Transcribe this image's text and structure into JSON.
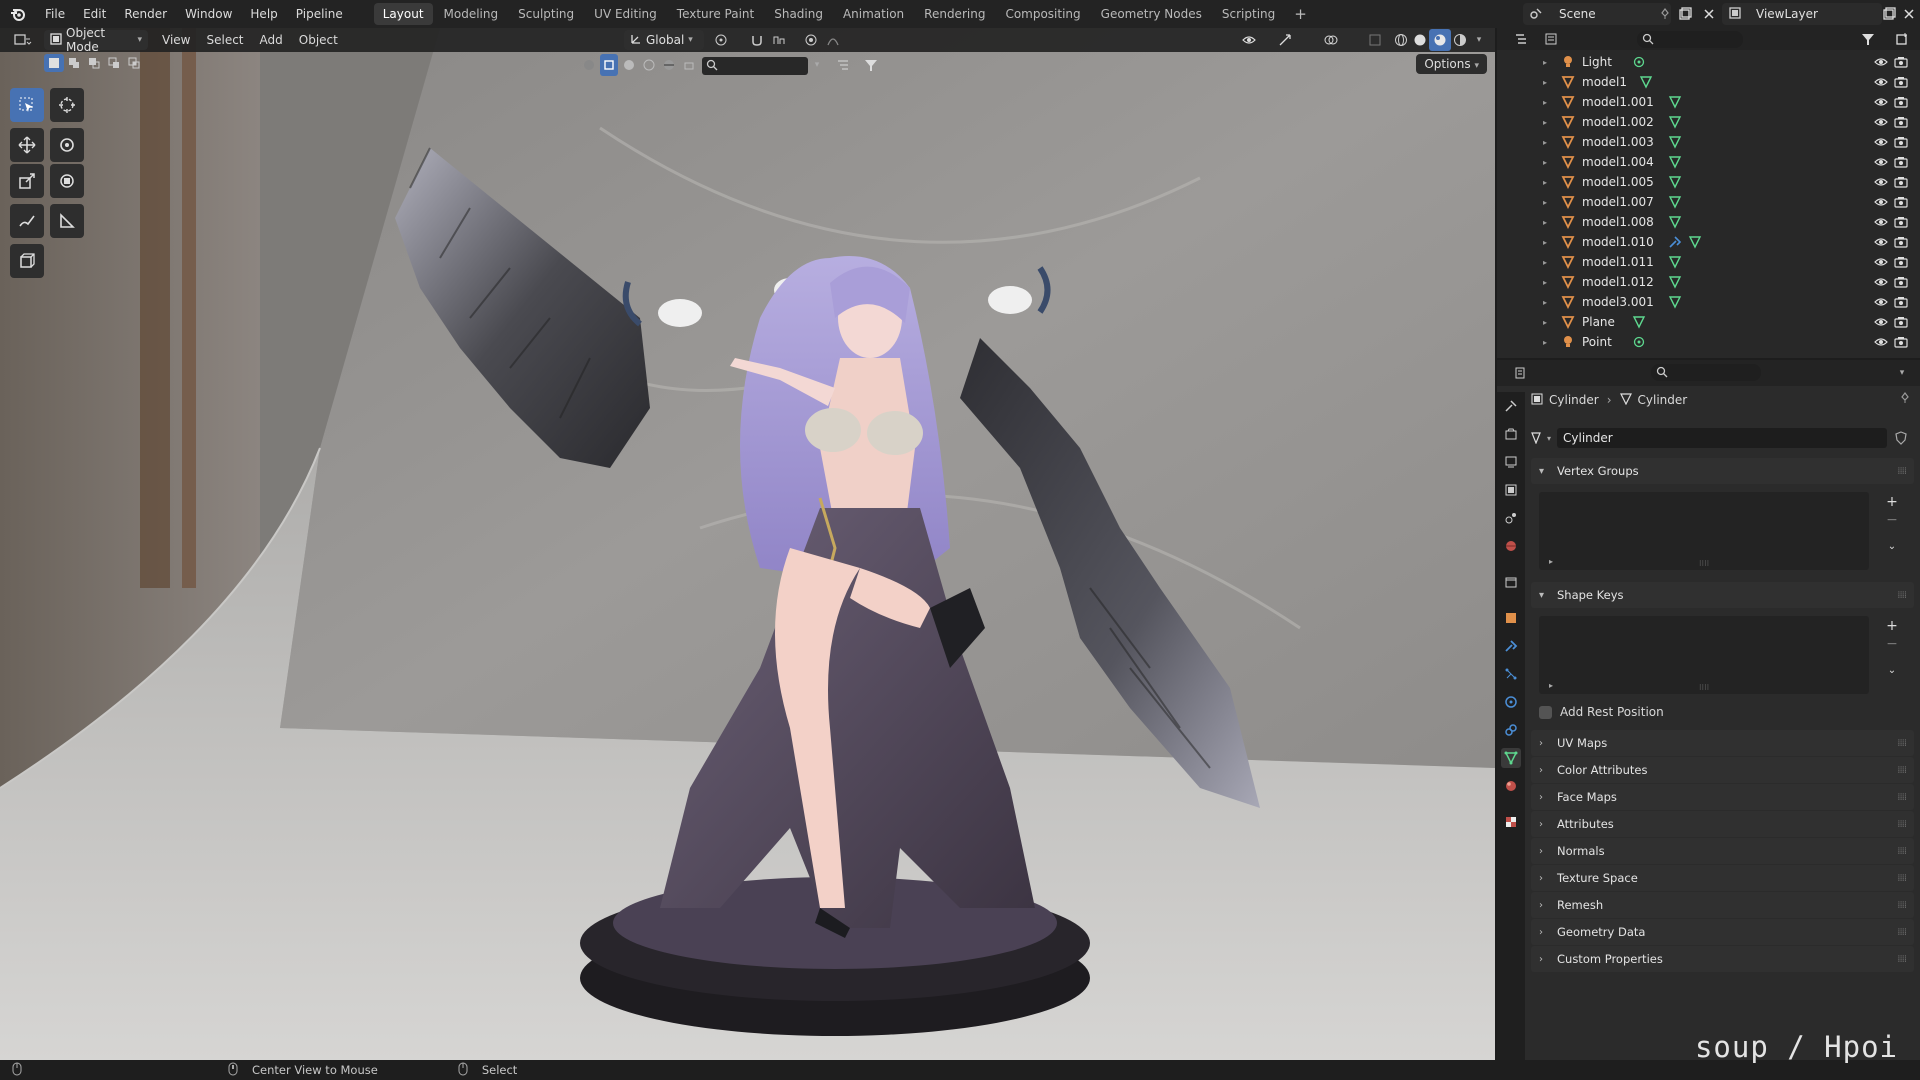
{
  "topbar": {
    "menus": [
      "File",
      "Edit",
      "Render",
      "Window",
      "Help",
      "Pipeline"
    ],
    "workspaces": [
      "Layout",
      "Modeling",
      "Sculpting",
      "UV Editing",
      "Texture Paint",
      "Shading",
      "Animation",
      "Rendering",
      "Compositing",
      "Geometry Nodes",
      "Scripting"
    ],
    "active_workspace": "Layout",
    "add_tab": "+",
    "scene_name": "Scene",
    "view_layer": "ViewLayer"
  },
  "viewport_header": {
    "mode": "Object Mode",
    "menus": [
      "View",
      "Select",
      "Add",
      "Object"
    ],
    "transform_orientation": "Global",
    "options_label": "Options"
  },
  "outliner": {
    "items": [
      {
        "name": "Light",
        "type": "light",
        "data": "light"
      },
      {
        "name": "model1",
        "type": "mesh",
        "data": "mesh"
      },
      {
        "name": "model1.001",
        "type": "mesh",
        "data": "mesh"
      },
      {
        "name": "model1.002",
        "type": "mesh",
        "data": "mesh"
      },
      {
        "name": "model1.003",
        "type": "mesh",
        "data": "mesh"
      },
      {
        "name": "model1.004",
        "type": "mesh",
        "data": "mesh"
      },
      {
        "name": "model1.005",
        "type": "mesh",
        "data": "mesh"
      },
      {
        "name": "model1.007",
        "type": "mesh",
        "data": "mesh"
      },
      {
        "name": "model1.008",
        "type": "mesh",
        "data": "mesh"
      },
      {
        "name": "model1.010",
        "type": "mesh",
        "data": "modifier+mesh"
      },
      {
        "name": "model1.011",
        "type": "mesh",
        "data": "mesh"
      },
      {
        "name": "model1.012",
        "type": "mesh",
        "data": "mesh"
      },
      {
        "name": "model3.001",
        "type": "mesh",
        "data": "mesh"
      },
      {
        "name": "Plane",
        "type": "mesh",
        "data": "mesh"
      },
      {
        "name": "Point",
        "type": "light",
        "data": "light"
      }
    ]
  },
  "properties": {
    "breadcrumb_object": "Cylinder",
    "breadcrumb_data": "Cylinder",
    "mesh_name": "Cylinder",
    "panels": {
      "vertex_groups": "Vertex Groups",
      "shape_keys": "Shape Keys",
      "add_rest_position": "Add Rest Position",
      "uv_maps": "UV Maps",
      "color_attributes": "Color Attributes",
      "face_maps": "Face Maps",
      "attributes": "Attributes",
      "normals": "Normals",
      "texture_space": "Texture Space",
      "remesh": "Remesh",
      "geometry_data": "Geometry Data",
      "custom_properties": "Custom Properties"
    }
  },
  "statusbar": {
    "mouse_middle_hint": "Center View to Mouse",
    "mouse_right_hint": "Select"
  },
  "watermark": "soup / Hpoi",
  "colors": {
    "accent": "#4772b3",
    "mesh_icon": "#e0904a",
    "data_icon": "#5ed88f",
    "light_icon": "#e0904a"
  }
}
